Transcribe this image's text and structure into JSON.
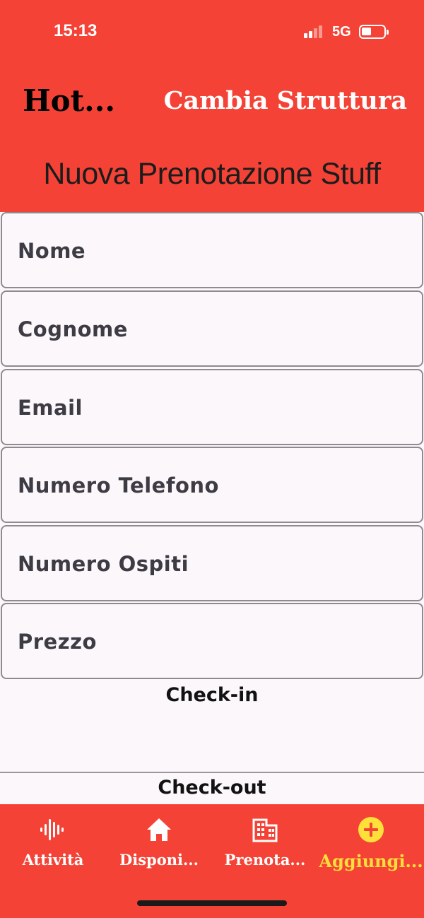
{
  "status_bar": {
    "time": "15:13",
    "network": "5G",
    "battery_level": 0.35
  },
  "header": {
    "app_title": "Hot...",
    "switch_button_label": "Cambia Struttura",
    "page_title": "Nuova Prenotazione Stuff"
  },
  "form": {
    "fields": [
      {
        "label": "Nome"
      },
      {
        "label": "Cognome"
      },
      {
        "label": "Email"
      },
      {
        "label": "Numero Telefono"
      },
      {
        "label": "Numero Ospiti"
      },
      {
        "label": "Prezzo"
      }
    ],
    "checkin_label": "Check-in",
    "checkout_label": "Check-out"
  },
  "tabbar": {
    "tabs": [
      {
        "label": "Attività",
        "icon": "waveform-icon"
      },
      {
        "label": "Disponi...",
        "icon": "home-icon"
      },
      {
        "label": "Prenota...",
        "icon": "building-icon"
      },
      {
        "label": "Aggiungi...",
        "icon": "plus-circle-icon",
        "active": true
      }
    ]
  },
  "colors": {
    "header": "#f44336",
    "background": "#fcf7fb",
    "active_tab": "#ffe03a"
  }
}
